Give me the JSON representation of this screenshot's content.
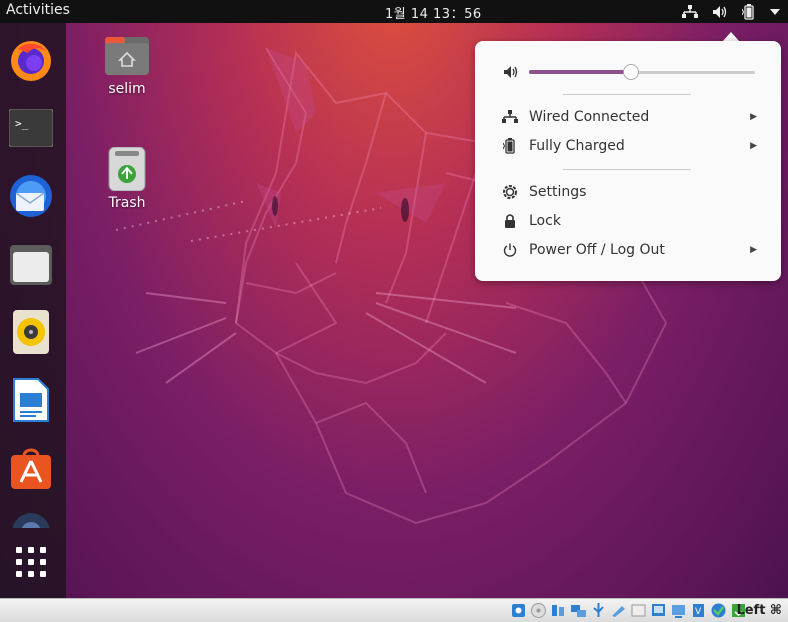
{
  "topbar": {
    "activities": "Activities",
    "clock": "1월 14  13：56",
    "tray_icons": [
      "network-wired-icon",
      "volume-icon",
      "battery-icon",
      "menu-arrow-icon"
    ]
  },
  "desktop": {
    "icons": [
      {
        "label": "selim",
        "icon": "home-folder-icon"
      },
      {
        "label": "Trash",
        "icon": "trash-icon"
      }
    ]
  },
  "dock": {
    "items": [
      "firefox-icon",
      "terminal-icon",
      "thunderbird-icon",
      "files-icon",
      "rhythmbox-icon",
      "libreoffice-writer-icon",
      "software-center-icon",
      "help-icon",
      "show-apps-icon"
    ]
  },
  "system_menu": {
    "volume_level": 0.45,
    "items": [
      {
        "label": "Wired Connected",
        "icon": "network-wired-icon",
        "submenu": true
      },
      {
        "label": "Fully Charged",
        "icon": "battery-icon",
        "submenu": true
      },
      {
        "label": "Settings",
        "icon": "gear-icon",
        "submenu": false
      },
      {
        "label": "Lock",
        "icon": "lock-icon",
        "submenu": false
      },
      {
        "label": "Power Off / Log Out",
        "icon": "power-icon",
        "submenu": true
      }
    ]
  },
  "statusbar": {
    "host_key": "Left ⌘"
  },
  "colors": {
    "accent": "#8e4f8d",
    "topbar": "#111111",
    "popup_bg": "#fafafa"
  }
}
